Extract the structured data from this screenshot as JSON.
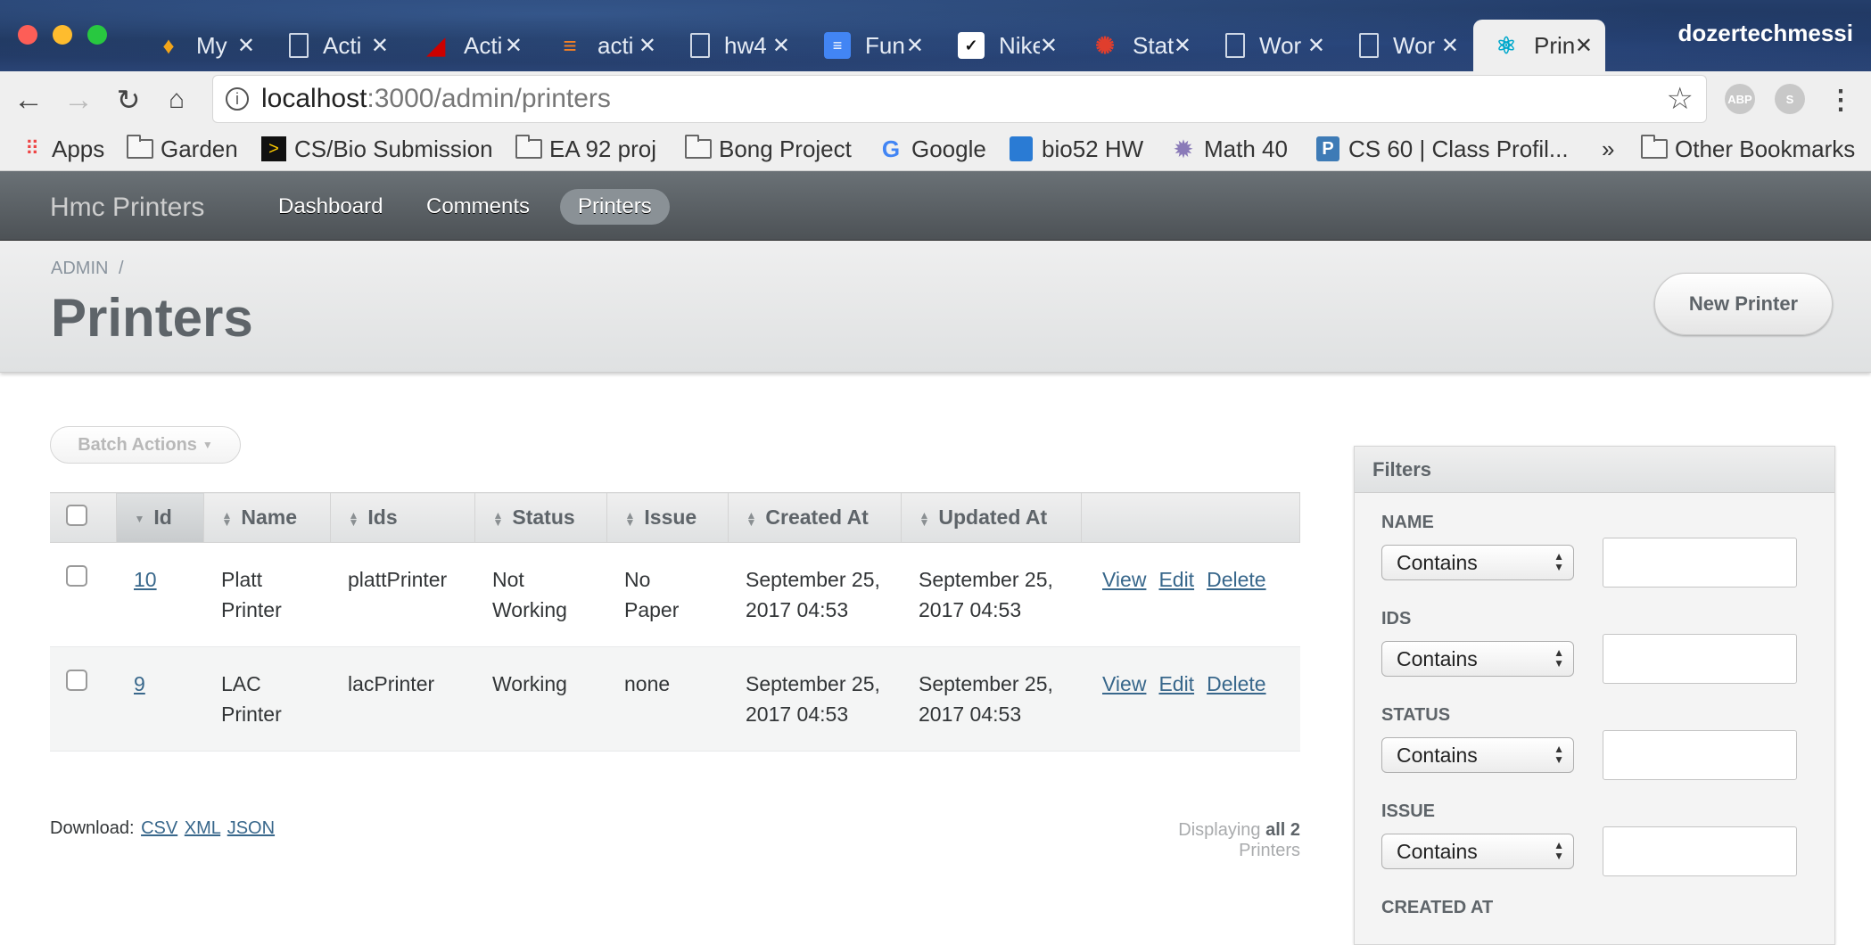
{
  "browser": {
    "tabs": [
      {
        "title": "My",
        "icon": "flame-logo-icon",
        "color": "#f2a51a",
        "active": false
      },
      {
        "title": "Acti",
        "icon": "document-icon",
        "color": "#cfd8e6",
        "active": false
      },
      {
        "title": "Acti",
        "icon": "rails-logo-icon",
        "color": "#cc0000",
        "active": false
      },
      {
        "title": "acti",
        "icon": "stackoverflow-icon",
        "color": "#f48024",
        "active": false
      },
      {
        "title": "hw4",
        "icon": "document-icon",
        "color": "#cfd8e6",
        "active": false
      },
      {
        "title": "Fun",
        "icon": "google-docs-icon",
        "color": "#4285f4",
        "active": false
      },
      {
        "title": "Nike",
        "icon": "nike-icon",
        "color": "#ffffff",
        "active": false
      },
      {
        "title": "Stat",
        "icon": "canvas-icon",
        "color": "#e03e2d",
        "active": false
      },
      {
        "title": "Wor",
        "icon": "document-icon",
        "color": "#cfd8e6",
        "active": false
      },
      {
        "title": "Wor",
        "icon": "document-icon",
        "color": "#cfd8e6",
        "active": false
      },
      {
        "title": "Prin",
        "icon": "react-icon",
        "color": "#00a8cc",
        "active": true
      }
    ],
    "profile_name": "dozertechmessi",
    "url_host": "localhost",
    "url_path": ":3000/admin/printers",
    "extensions": [
      {
        "name": "abp-extension-icon",
        "label": "ABP",
        "color": "#c8c8c8"
      },
      {
        "name": "skype-extension-icon",
        "label": "S",
        "color": "#c8c8c8"
      }
    ]
  },
  "bookmarks": [
    {
      "label": "Apps",
      "icon": "apps-grid-icon"
    },
    {
      "label": "Garden",
      "icon": "folder-icon"
    },
    {
      "label": "CS/Bio Submission",
      "icon": "arrow-logo-icon"
    },
    {
      "label": "EA 92 proj",
      "icon": "folder-icon"
    },
    {
      "label": "Bong Project",
      "icon": "folder-icon"
    },
    {
      "label": "Google",
      "icon": "google-icon"
    },
    {
      "label": "bio52 HW",
      "icon": "trello-icon"
    },
    {
      "label": "Math 40",
      "icon": "gear-logo-icon"
    },
    {
      "label": "CS 60 | Class Profil...",
      "icon": "piazza-icon"
    },
    {
      "label": "»",
      "icon": ""
    },
    {
      "label": "Other Bookmarks",
      "icon": "folder-icon"
    }
  ],
  "app": {
    "site_title": "Hmc Printers",
    "nav": [
      {
        "label": "Dashboard",
        "current": false
      },
      {
        "label": "Comments",
        "current": false
      },
      {
        "label": "Printers",
        "current": true
      }
    ],
    "breadcrumb": "ADMIN",
    "breadcrumb_sep": "/",
    "page_title": "Printers",
    "new_button": "New Printer",
    "batch_actions": "Batch Actions"
  },
  "table": {
    "columns": [
      "Id",
      "Name",
      "Ids",
      "Status",
      "Issue",
      "Created At",
      "Updated At"
    ],
    "rows": [
      {
        "id": "10",
        "name": "Platt Printer",
        "ids": "plattPrinter",
        "status": "Not Working",
        "issue": "No Paper",
        "created_at": "September 25, 2017 04:53",
        "updated_at": "September 25, 2017 04:53"
      },
      {
        "id": "9",
        "name": "LAC Printer",
        "ids": "lacPrinter",
        "status": "Working",
        "issue": "none",
        "created_at": "September 25, 2017 04:53",
        "updated_at": "September 25, 2017 04:53"
      }
    ],
    "actions": [
      "View",
      "Edit",
      "Delete"
    ]
  },
  "footer": {
    "download_label": "Download:",
    "formats": [
      "CSV",
      "XML",
      "JSON"
    ],
    "display_prefix": "Displaying",
    "display_bold": "all 2",
    "display_suffix": "Printers"
  },
  "filters": {
    "title": "Filters",
    "fields": [
      {
        "label": "NAME",
        "option": "Contains"
      },
      {
        "label": "IDS",
        "option": "Contains"
      },
      {
        "label": "STATUS",
        "option": "Contains"
      },
      {
        "label": "ISSUE",
        "option": "Contains"
      }
    ],
    "next_label": "CREATED AT"
  }
}
